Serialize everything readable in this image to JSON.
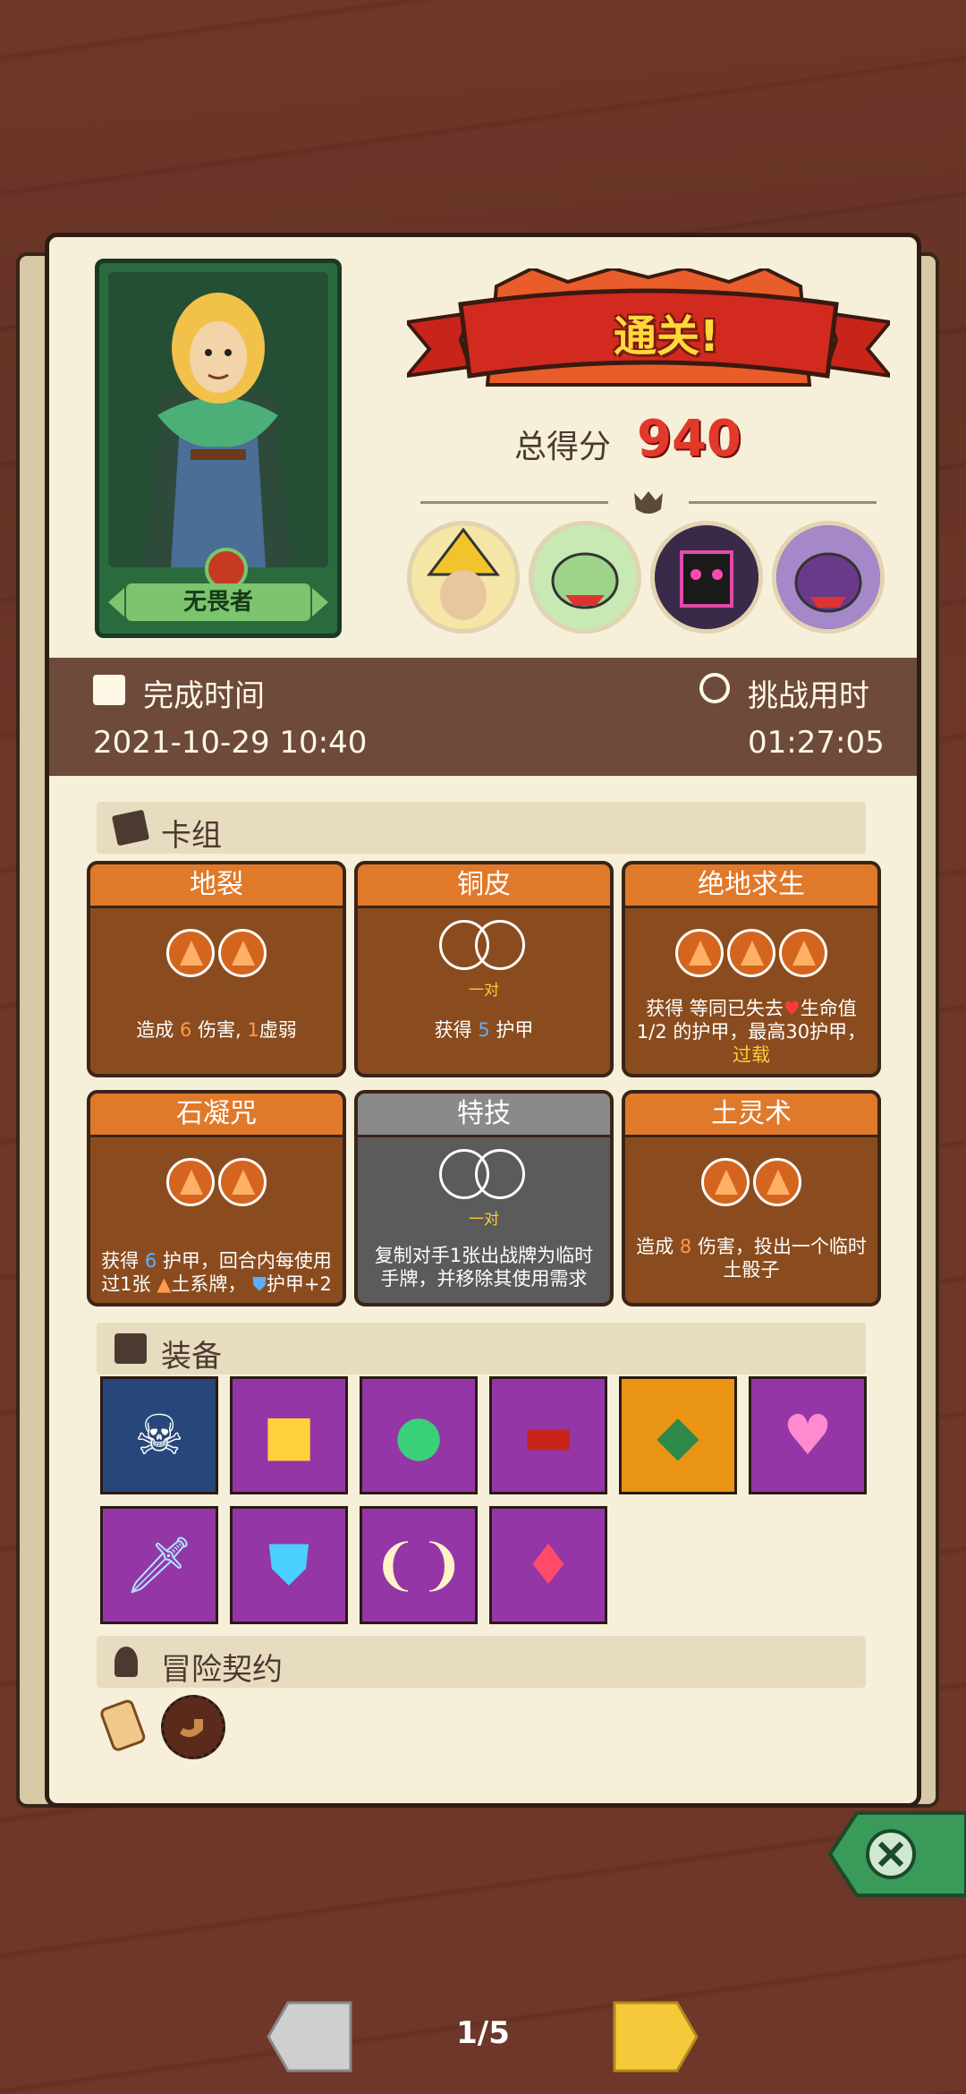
{
  "hero": {
    "name": "无畏者"
  },
  "result": {
    "banner": "通关!",
    "score_label": "总得分",
    "score_value": "940"
  },
  "time": {
    "completion_label": "完成时间",
    "completion_value": "2021-10-29 10:40",
    "duration_label": "挑战用时",
    "duration_value": "01:27:05"
  },
  "deck": {
    "title": "卡组",
    "cards": [
      {
        "name": "地裂",
        "desc_pre": "造成",
        "n1": "6",
        "mid": "伤害,",
        "n2": "1",
        "post": "虚弱"
      },
      {
        "name": "铜皮",
        "pair_label": "一对",
        "desc_pre": "获得",
        "n1": "5",
        "post": "护甲"
      },
      {
        "name": "绝地求生",
        "desc": "获得 等同已失去",
        "desc2": "生命值1/2 的护甲，最高30护甲，",
        "keyword": "过载"
      },
      {
        "name": "石凝咒",
        "desc": "获得",
        "n1": "6",
        "desc2": "护甲，回合内每使用过1张",
        "desc3": "土系牌，",
        "desc4": "护甲+2"
      },
      {
        "name": "特技",
        "pair_label": "一对",
        "desc": "复制对手1张出战牌为临时手牌，并移除其使用需求"
      },
      {
        "name": "土灵术",
        "desc_pre": "造成",
        "n1": "8",
        "post": "伤害，投出一个临时土骰子"
      }
    ]
  },
  "equipment": {
    "title": "装备"
  },
  "contracts": {
    "title": "冒险契约"
  },
  "pager": "1/5",
  "colors": {
    "accent_red": "#e23a2a",
    "card_orange": "#e0792a",
    "panel": "#f6efd9",
    "band": "#6e4a3a"
  }
}
